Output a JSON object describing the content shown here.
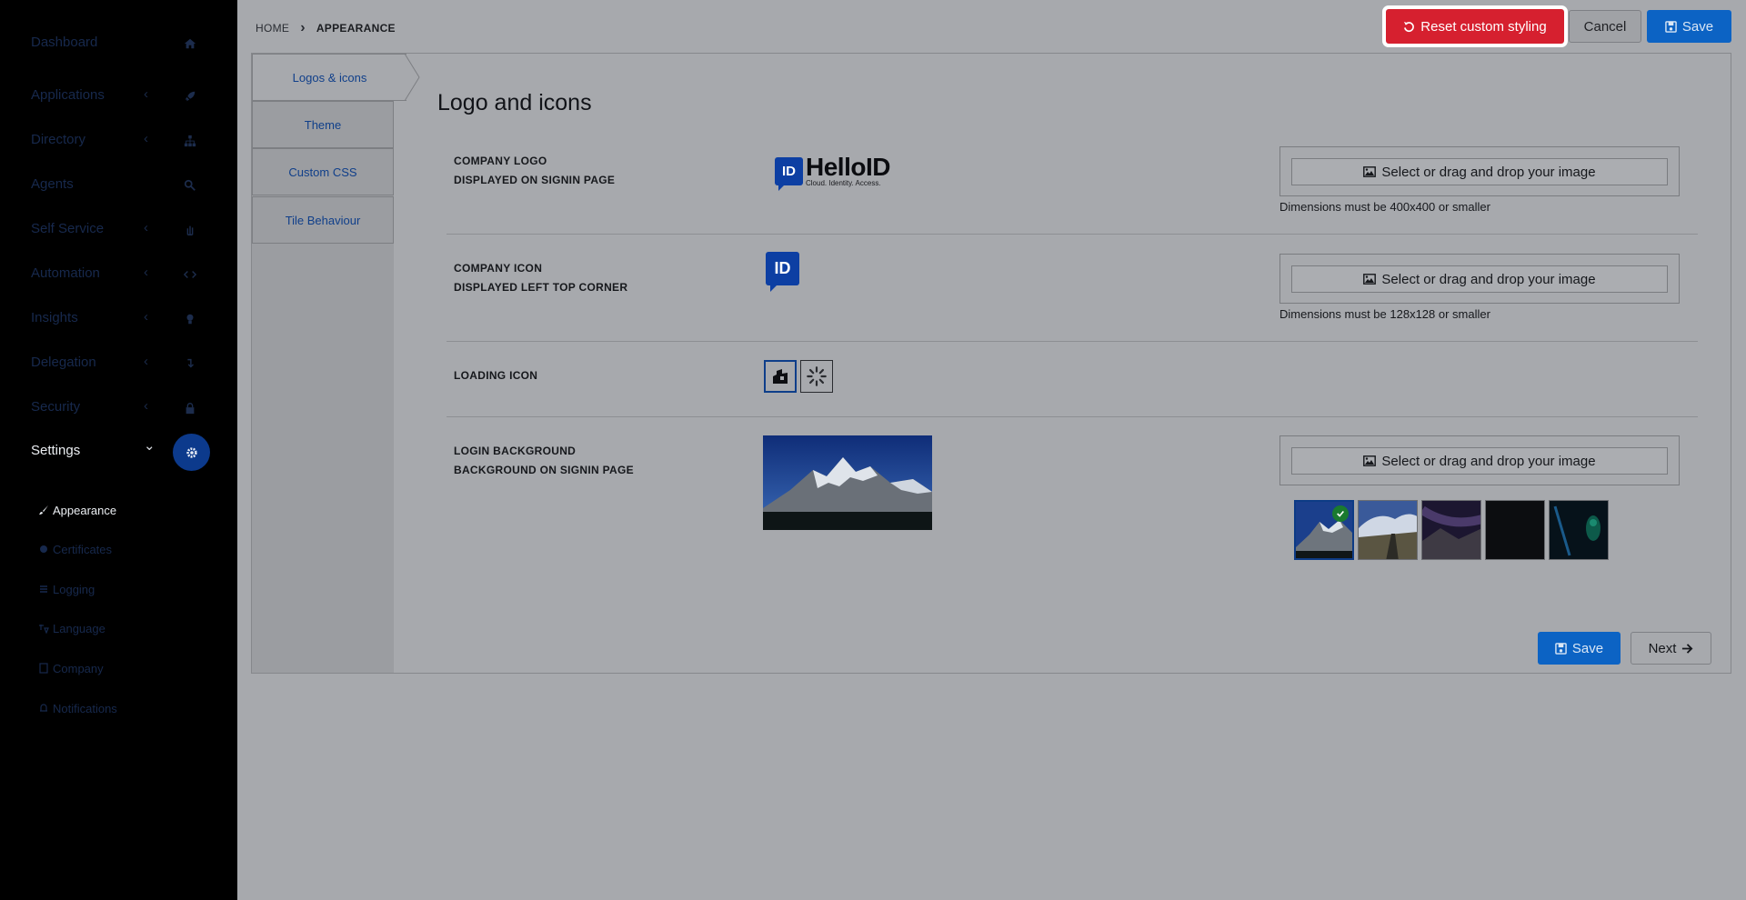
{
  "sidebar": {
    "items": [
      {
        "label": "Dashboard",
        "icon": "home-icon",
        "has_chevron": false
      },
      {
        "label": "Applications",
        "icon": "rocket-icon",
        "has_chevron": true
      },
      {
        "label": "Directory",
        "icon": "sitemap-icon",
        "has_chevron": true
      },
      {
        "label": "Agents",
        "icon": "agents-icon",
        "has_chevron": false
      },
      {
        "label": "Self Service",
        "icon": "hand-icon",
        "has_chevron": true
      },
      {
        "label": "Automation",
        "icon": "code-icon",
        "has_chevron": true
      },
      {
        "label": "Insights",
        "icon": "lightbulb-icon",
        "has_chevron": true
      },
      {
        "label": "Delegation",
        "icon": "delegation-icon",
        "has_chevron": true
      },
      {
        "label": "Security",
        "icon": "lock-icon",
        "has_chevron": true
      },
      {
        "label": "Settings",
        "icon": "gear-icon",
        "has_chevron": true,
        "active": true
      }
    ],
    "chevron_left": "‹",
    "chevron_down": "⌄",
    "subitems": [
      {
        "label": "Appearance",
        "icon": "brush-icon",
        "active": true
      },
      {
        "label": "Certificates",
        "icon": "certificate-icon"
      },
      {
        "label": "Logging",
        "icon": "list-icon"
      },
      {
        "label": "Language",
        "icon": "language-icon"
      },
      {
        "label": "Company",
        "icon": "building-icon"
      },
      {
        "label": "Notifications",
        "icon": "bell-icon"
      }
    ]
  },
  "breadcrumb": {
    "home": "HOME",
    "separator": "›",
    "current": "APPEARANCE"
  },
  "toolbar": {
    "reset_label": "Reset custom styling",
    "cancel_label": "Cancel",
    "save_label": "Save"
  },
  "tabs": [
    {
      "label": "Logos & icons",
      "active": true
    },
    {
      "label": "Theme"
    },
    {
      "label": "Custom CSS"
    },
    {
      "label": "Tile Behaviour"
    }
  ],
  "section": {
    "title": "Logo and icons",
    "rows": {
      "company_logo": {
        "title": "COMPANY LOGO",
        "subtitle": "DISPLAYED ON SIGNIN PAGE",
        "upload_label": "Select or drag and drop your image",
        "note": "Dimensions must be 400x400 or smaller"
      },
      "company_icon": {
        "title": "COMPANY ICON",
        "subtitle": "DISPLAYED LEFT TOP CORNER",
        "upload_label": "Select or drag and drop your image",
        "note": "Dimensions must be 128x128 or smaller"
      },
      "loading_icon": {
        "title": "LOADING ICON"
      },
      "login_background": {
        "title": "LOGIN BACKGROUND",
        "subtitle": "BACKGROUND ON SIGNIN PAGE",
        "upload_label": "Select or drag and drop your image"
      }
    }
  },
  "logo": {
    "badge": "ID",
    "wordmark": "HelloID",
    "tagline": "Cloud. Identity. Access."
  },
  "footer": {
    "save_label": "Save",
    "next_label": "Next"
  },
  "colors": {
    "accent": "#0c63c4",
    "danger": "#d6202f",
    "sidebar_bg": "#000000"
  }
}
